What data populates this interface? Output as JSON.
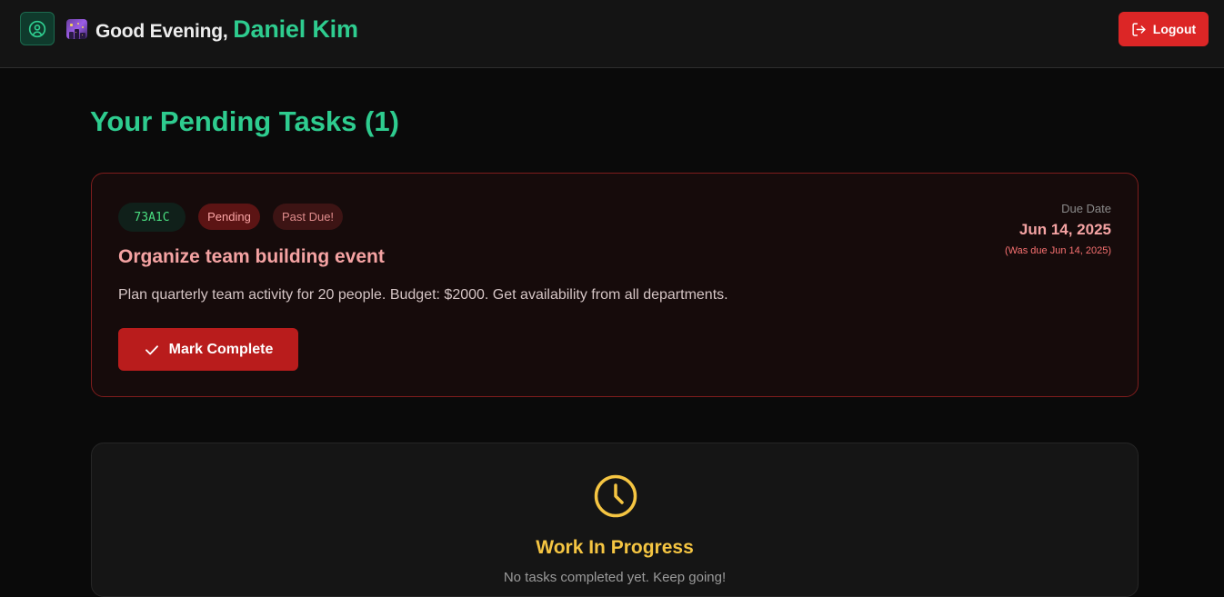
{
  "header": {
    "greeting": "Good Evening,",
    "user_name": "Daniel Kim",
    "avatar_icon": "user-circle-icon",
    "emoji_icon": "night-city-emoji-icon",
    "logout_label": "Logout",
    "logout_icon": "logout-icon"
  },
  "main": {
    "section_title": "Your Pending Tasks (1)",
    "tasks": [
      {
        "id": "73A1C",
        "status": "Pending",
        "flag": "Past Due!",
        "title": "Organize team building event",
        "description": "Plan quarterly team activity for 20 people. Budget: $2000. Get availability from all departments.",
        "due_label": "Due Date",
        "due_date": "Jun 14, 2025",
        "was_due": "(Was due Jun 14, 2025)",
        "action_label": "Mark Complete",
        "action_icon": "check-icon"
      }
    ],
    "progress": {
      "icon": "clock-icon",
      "title": "Work In Progress",
      "subtitle": "No tasks completed yet. Keep going!"
    }
  },
  "colors": {
    "accent": "#2ecc8f",
    "danger": "#dc2626",
    "warning": "#f5c542",
    "background": "#0a0a0a"
  }
}
